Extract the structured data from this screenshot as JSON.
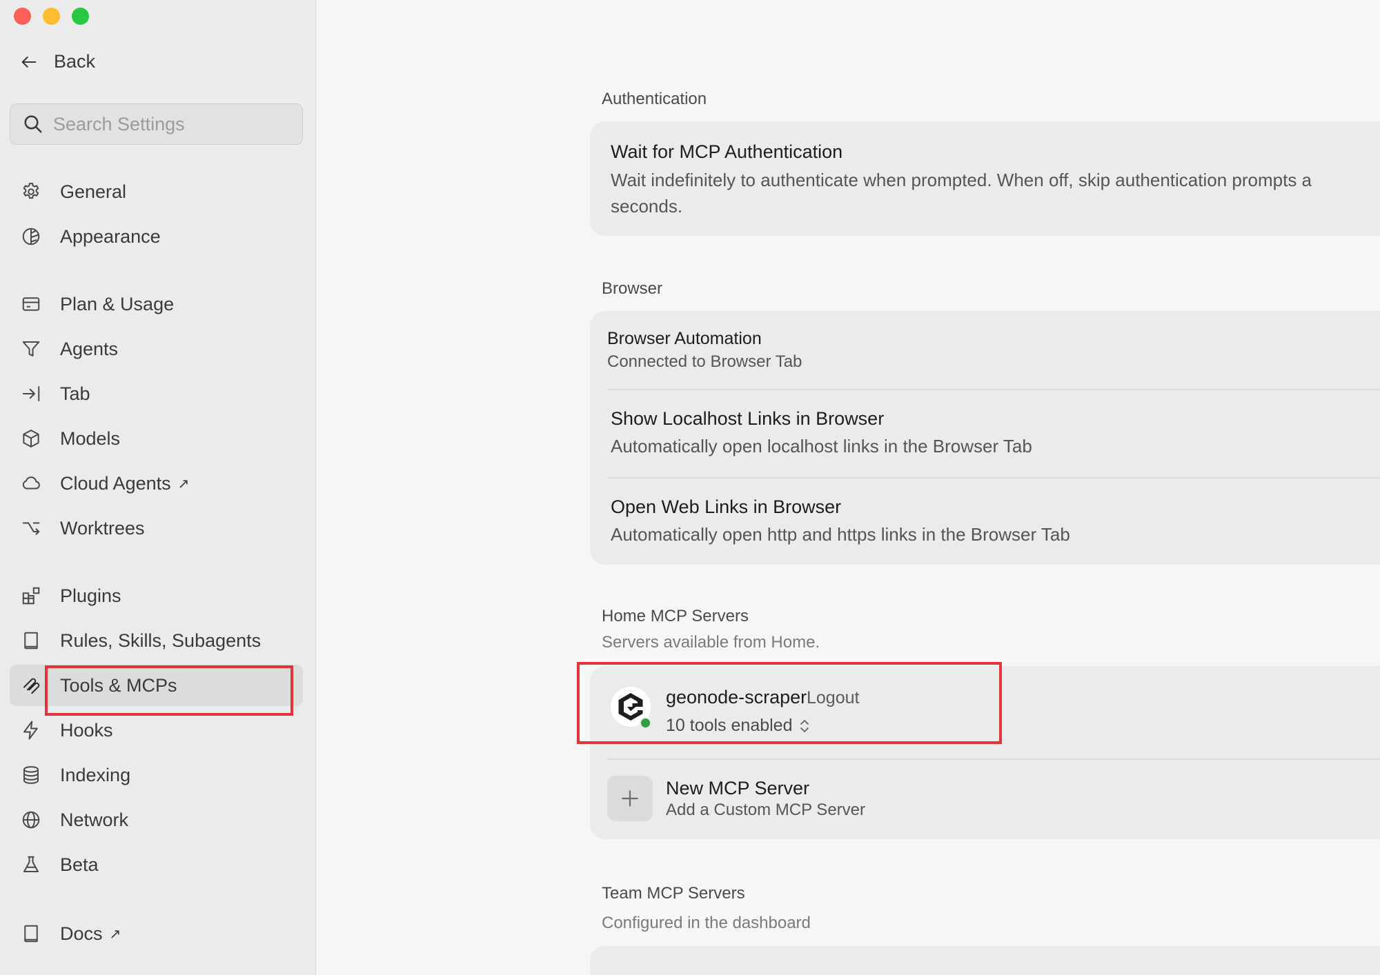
{
  "sidebar": {
    "back_label": "Back",
    "search_placeholder": "Search Settings",
    "items": [
      {
        "label": "General",
        "icon": "gear-icon"
      },
      {
        "label": "Appearance",
        "icon": "appearance-icon"
      },
      {
        "label": "Plan & Usage",
        "icon": "card-icon"
      },
      {
        "label": "Agents",
        "icon": "funnel-icon"
      },
      {
        "label": "Tab",
        "icon": "tab-arrow-icon"
      },
      {
        "label": "Models",
        "icon": "cube-icon"
      },
      {
        "label": "Cloud Agents",
        "icon": "cloud-icon",
        "external": "↗"
      },
      {
        "label": "Worktrees",
        "icon": "branch-icon"
      },
      {
        "label": "Plugins",
        "icon": "plugins-icon"
      },
      {
        "label": "Rules, Skills, Subagents",
        "icon": "book-icon"
      },
      {
        "label": "Tools & MCPs",
        "icon": "tools-icon",
        "active": true
      },
      {
        "label": "Hooks",
        "icon": "bolt-icon"
      },
      {
        "label": "Indexing",
        "icon": "database-icon"
      },
      {
        "label": "Network",
        "icon": "globe-icon"
      },
      {
        "label": "Beta",
        "icon": "flask-icon"
      },
      {
        "label": "Docs",
        "icon": "docs-icon",
        "external": "↗"
      }
    ]
  },
  "main": {
    "authentication": {
      "title": "Authentication",
      "wait_title": "Wait for MCP Authentication",
      "wait_desc_1": "Wait indefinitely to authenticate when prompted. When off, skip authentication prompts a",
      "wait_desc_2": "seconds."
    },
    "browser": {
      "title": "Browser",
      "automation_title": "Browser Automation",
      "automation_desc": "Connected to Browser Tab",
      "localhost_title": "Show Localhost Links in Browser",
      "localhost_desc": "Automatically open localhost links in the Browser Tab",
      "weblinks_title": "Open Web Links in Browser",
      "weblinks_desc": "Automatically open http and https links in the Browser Tab"
    },
    "home_mcp": {
      "title": "Home MCP Servers",
      "subtitle": "Servers available from Home.",
      "server_name": "geonode-scraper",
      "logout_label": "Logout",
      "tools_enabled": "10 tools enabled",
      "new_title": "New MCP Server",
      "new_desc": "Add a Custom MCP Server"
    },
    "team_mcp": {
      "title": "Team MCP Servers",
      "subtitle": "Configured in the dashboard"
    }
  },
  "colors": {
    "highlight": "#e8323a",
    "status_online": "#2ea043"
  }
}
